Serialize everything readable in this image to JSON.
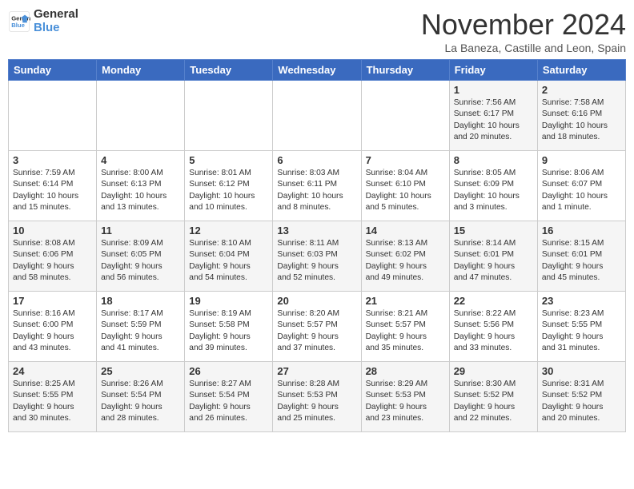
{
  "logo": {
    "line1": "General",
    "line2": "Blue"
  },
  "title": "November 2024",
  "location": "La Baneza, Castille and Leon, Spain",
  "weekdays": [
    "Sunday",
    "Monday",
    "Tuesday",
    "Wednesday",
    "Thursday",
    "Friday",
    "Saturday"
  ],
  "weeks": [
    [
      {
        "day": "",
        "info": ""
      },
      {
        "day": "",
        "info": ""
      },
      {
        "day": "",
        "info": ""
      },
      {
        "day": "",
        "info": ""
      },
      {
        "day": "",
        "info": ""
      },
      {
        "day": "1",
        "info": "Sunrise: 7:56 AM\nSunset: 6:17 PM\nDaylight: 10 hours\nand 20 minutes."
      },
      {
        "day": "2",
        "info": "Sunrise: 7:58 AM\nSunset: 6:16 PM\nDaylight: 10 hours\nand 18 minutes."
      }
    ],
    [
      {
        "day": "3",
        "info": "Sunrise: 7:59 AM\nSunset: 6:14 PM\nDaylight: 10 hours\nand 15 minutes."
      },
      {
        "day": "4",
        "info": "Sunrise: 8:00 AM\nSunset: 6:13 PM\nDaylight: 10 hours\nand 13 minutes."
      },
      {
        "day": "5",
        "info": "Sunrise: 8:01 AM\nSunset: 6:12 PM\nDaylight: 10 hours\nand 10 minutes."
      },
      {
        "day": "6",
        "info": "Sunrise: 8:03 AM\nSunset: 6:11 PM\nDaylight: 10 hours\nand 8 minutes."
      },
      {
        "day": "7",
        "info": "Sunrise: 8:04 AM\nSunset: 6:10 PM\nDaylight: 10 hours\nand 5 minutes."
      },
      {
        "day": "8",
        "info": "Sunrise: 8:05 AM\nSunset: 6:09 PM\nDaylight: 10 hours\nand 3 minutes."
      },
      {
        "day": "9",
        "info": "Sunrise: 8:06 AM\nSunset: 6:07 PM\nDaylight: 10 hours\nand 1 minute."
      }
    ],
    [
      {
        "day": "10",
        "info": "Sunrise: 8:08 AM\nSunset: 6:06 PM\nDaylight: 9 hours\nand 58 minutes."
      },
      {
        "day": "11",
        "info": "Sunrise: 8:09 AM\nSunset: 6:05 PM\nDaylight: 9 hours\nand 56 minutes."
      },
      {
        "day": "12",
        "info": "Sunrise: 8:10 AM\nSunset: 6:04 PM\nDaylight: 9 hours\nand 54 minutes."
      },
      {
        "day": "13",
        "info": "Sunrise: 8:11 AM\nSunset: 6:03 PM\nDaylight: 9 hours\nand 52 minutes."
      },
      {
        "day": "14",
        "info": "Sunrise: 8:13 AM\nSunset: 6:02 PM\nDaylight: 9 hours\nand 49 minutes."
      },
      {
        "day": "15",
        "info": "Sunrise: 8:14 AM\nSunset: 6:01 PM\nDaylight: 9 hours\nand 47 minutes."
      },
      {
        "day": "16",
        "info": "Sunrise: 8:15 AM\nSunset: 6:01 PM\nDaylight: 9 hours\nand 45 minutes."
      }
    ],
    [
      {
        "day": "17",
        "info": "Sunrise: 8:16 AM\nSunset: 6:00 PM\nDaylight: 9 hours\nand 43 minutes."
      },
      {
        "day": "18",
        "info": "Sunrise: 8:17 AM\nSunset: 5:59 PM\nDaylight: 9 hours\nand 41 minutes."
      },
      {
        "day": "19",
        "info": "Sunrise: 8:19 AM\nSunset: 5:58 PM\nDaylight: 9 hours\nand 39 minutes."
      },
      {
        "day": "20",
        "info": "Sunrise: 8:20 AM\nSunset: 5:57 PM\nDaylight: 9 hours\nand 37 minutes."
      },
      {
        "day": "21",
        "info": "Sunrise: 8:21 AM\nSunset: 5:57 PM\nDaylight: 9 hours\nand 35 minutes."
      },
      {
        "day": "22",
        "info": "Sunrise: 8:22 AM\nSunset: 5:56 PM\nDaylight: 9 hours\nand 33 minutes."
      },
      {
        "day": "23",
        "info": "Sunrise: 8:23 AM\nSunset: 5:55 PM\nDaylight: 9 hours\nand 31 minutes."
      }
    ],
    [
      {
        "day": "24",
        "info": "Sunrise: 8:25 AM\nSunset: 5:55 PM\nDaylight: 9 hours\nand 30 minutes."
      },
      {
        "day": "25",
        "info": "Sunrise: 8:26 AM\nSunset: 5:54 PM\nDaylight: 9 hours\nand 28 minutes."
      },
      {
        "day": "26",
        "info": "Sunrise: 8:27 AM\nSunset: 5:54 PM\nDaylight: 9 hours\nand 26 minutes."
      },
      {
        "day": "27",
        "info": "Sunrise: 8:28 AM\nSunset: 5:53 PM\nDaylight: 9 hours\nand 25 minutes."
      },
      {
        "day": "28",
        "info": "Sunrise: 8:29 AM\nSunset: 5:53 PM\nDaylight: 9 hours\nand 23 minutes."
      },
      {
        "day": "29",
        "info": "Sunrise: 8:30 AM\nSunset: 5:52 PM\nDaylight: 9 hours\nand 22 minutes."
      },
      {
        "day": "30",
        "info": "Sunrise: 8:31 AM\nSunset: 5:52 PM\nDaylight: 9 hours\nand 20 minutes."
      }
    ]
  ]
}
